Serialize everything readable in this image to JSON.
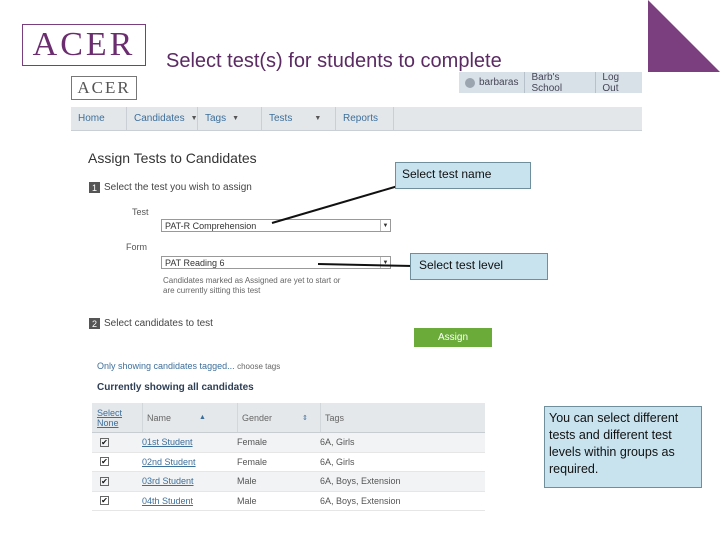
{
  "slide": {
    "logo_text": "ACER",
    "title": "Select test(s) for students to complete"
  },
  "app": {
    "logo_text": "ACER",
    "user": {
      "username": "barbaras",
      "school": "Barb's School",
      "logout": "Log Out"
    },
    "nav": [
      {
        "label": "Home",
        "caret": ""
      },
      {
        "label": "Candidates",
        "caret": "▼"
      },
      {
        "label": "Tags",
        "caret": "▼"
      },
      {
        "label": "Tests",
        "caret": "▼"
      },
      {
        "label": "Reports",
        "caret": ""
      }
    ],
    "page_title": "Assign Tests to Candidates",
    "step1": {
      "num": "1",
      "label": "Select the test you wish to assign"
    },
    "test_label": "Test",
    "test_value": "PAT-R Comprehension",
    "form_label": "Form",
    "form_value": "PAT Reading 6",
    "form_note": "Candidates marked as Assigned are yet to start or are currently sitting this test",
    "step2": {
      "num": "2",
      "label": "Select candidates to test"
    },
    "assign_button": "Assign",
    "filter_text": "Only showing candidates tagged...",
    "filter_choose": "choose tags",
    "currently_showing": "Currently showing all candidates",
    "table": {
      "headers": {
        "select": "Select",
        "select_none": "None",
        "name": "Name",
        "gender": "Gender",
        "tags": "Tags"
      },
      "rows": [
        {
          "checked": "✔",
          "name": "01st Student",
          "gender": "Female",
          "tags": "6A, Girls"
        },
        {
          "checked": "✔",
          "name": "02nd Student",
          "gender": "Female",
          "tags": "6A, Girls"
        },
        {
          "checked": "✔",
          "name": "03rd Student",
          "gender": "Male",
          "tags": "6A, Boys, Extension"
        },
        {
          "checked": "✔",
          "name": "04th Student",
          "gender": "Male",
          "tags": "6A, Boys, Extension"
        }
      ]
    }
  },
  "callouts": {
    "test_name": "Select test name",
    "test_level": "Select test level",
    "note": "You can select different tests and different test levels within groups as required."
  },
  "colors": {
    "brand_purple": "#6b2d6f",
    "callout_bg": "#c9e3ee",
    "assign_green": "#6aab39"
  }
}
